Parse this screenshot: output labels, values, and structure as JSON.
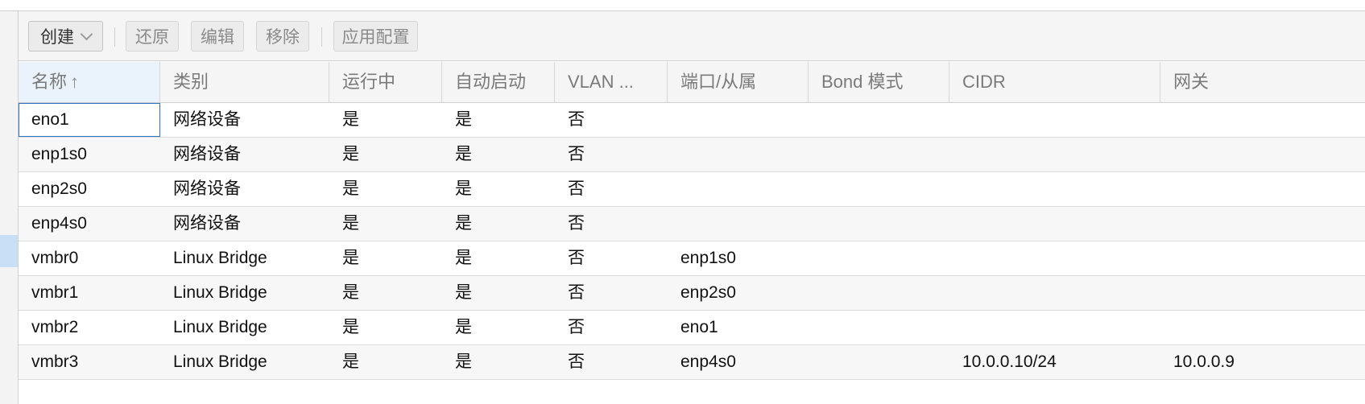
{
  "toolbar": {
    "create_label": "创建",
    "revert_label": "还原",
    "edit_label": "编辑",
    "remove_label": "移除",
    "apply_label": "应用配置"
  },
  "columns": [
    "名称",
    "类别",
    "运行中",
    "自动启动",
    "VLAN ...",
    "端口/从属",
    "Bond 模式",
    "CIDR",
    "网关"
  ],
  "sort": {
    "column": "名称",
    "direction": "ascending",
    "arrow": "↑"
  },
  "rows": [
    [
      "eno1",
      "网络设备",
      "是",
      "是",
      "否",
      "",
      "",
      "",
      ""
    ],
    [
      "enp1s0",
      "网络设备",
      "是",
      "是",
      "否",
      "",
      "",
      "",
      ""
    ],
    [
      "enp2s0",
      "网络设备",
      "是",
      "是",
      "否",
      "",
      "",
      "",
      ""
    ],
    [
      "enp4s0",
      "网络设备",
      "是",
      "是",
      "否",
      "",
      "",
      "",
      ""
    ],
    [
      "vmbr0",
      "Linux Bridge",
      "是",
      "是",
      "否",
      "enp1s0",
      "",
      "",
      ""
    ],
    [
      "vmbr1",
      "Linux Bridge",
      "是",
      "是",
      "否",
      "enp2s0",
      "",
      "",
      ""
    ],
    [
      "vmbr2",
      "Linux Bridge",
      "是",
      "是",
      "否",
      "eno1",
      "",
      "",
      ""
    ],
    [
      "vmbr3",
      "Linux Bridge",
      "是",
      "是",
      "否",
      "enp4s0",
      "",
      "10.0.0.10/24",
      "10.0.0.9"
    ]
  ],
  "colors": {
    "focus_border": "#2a72c4",
    "sorted_header_bg": "#eaf2fb",
    "selection_marker": "#c8dff5"
  }
}
